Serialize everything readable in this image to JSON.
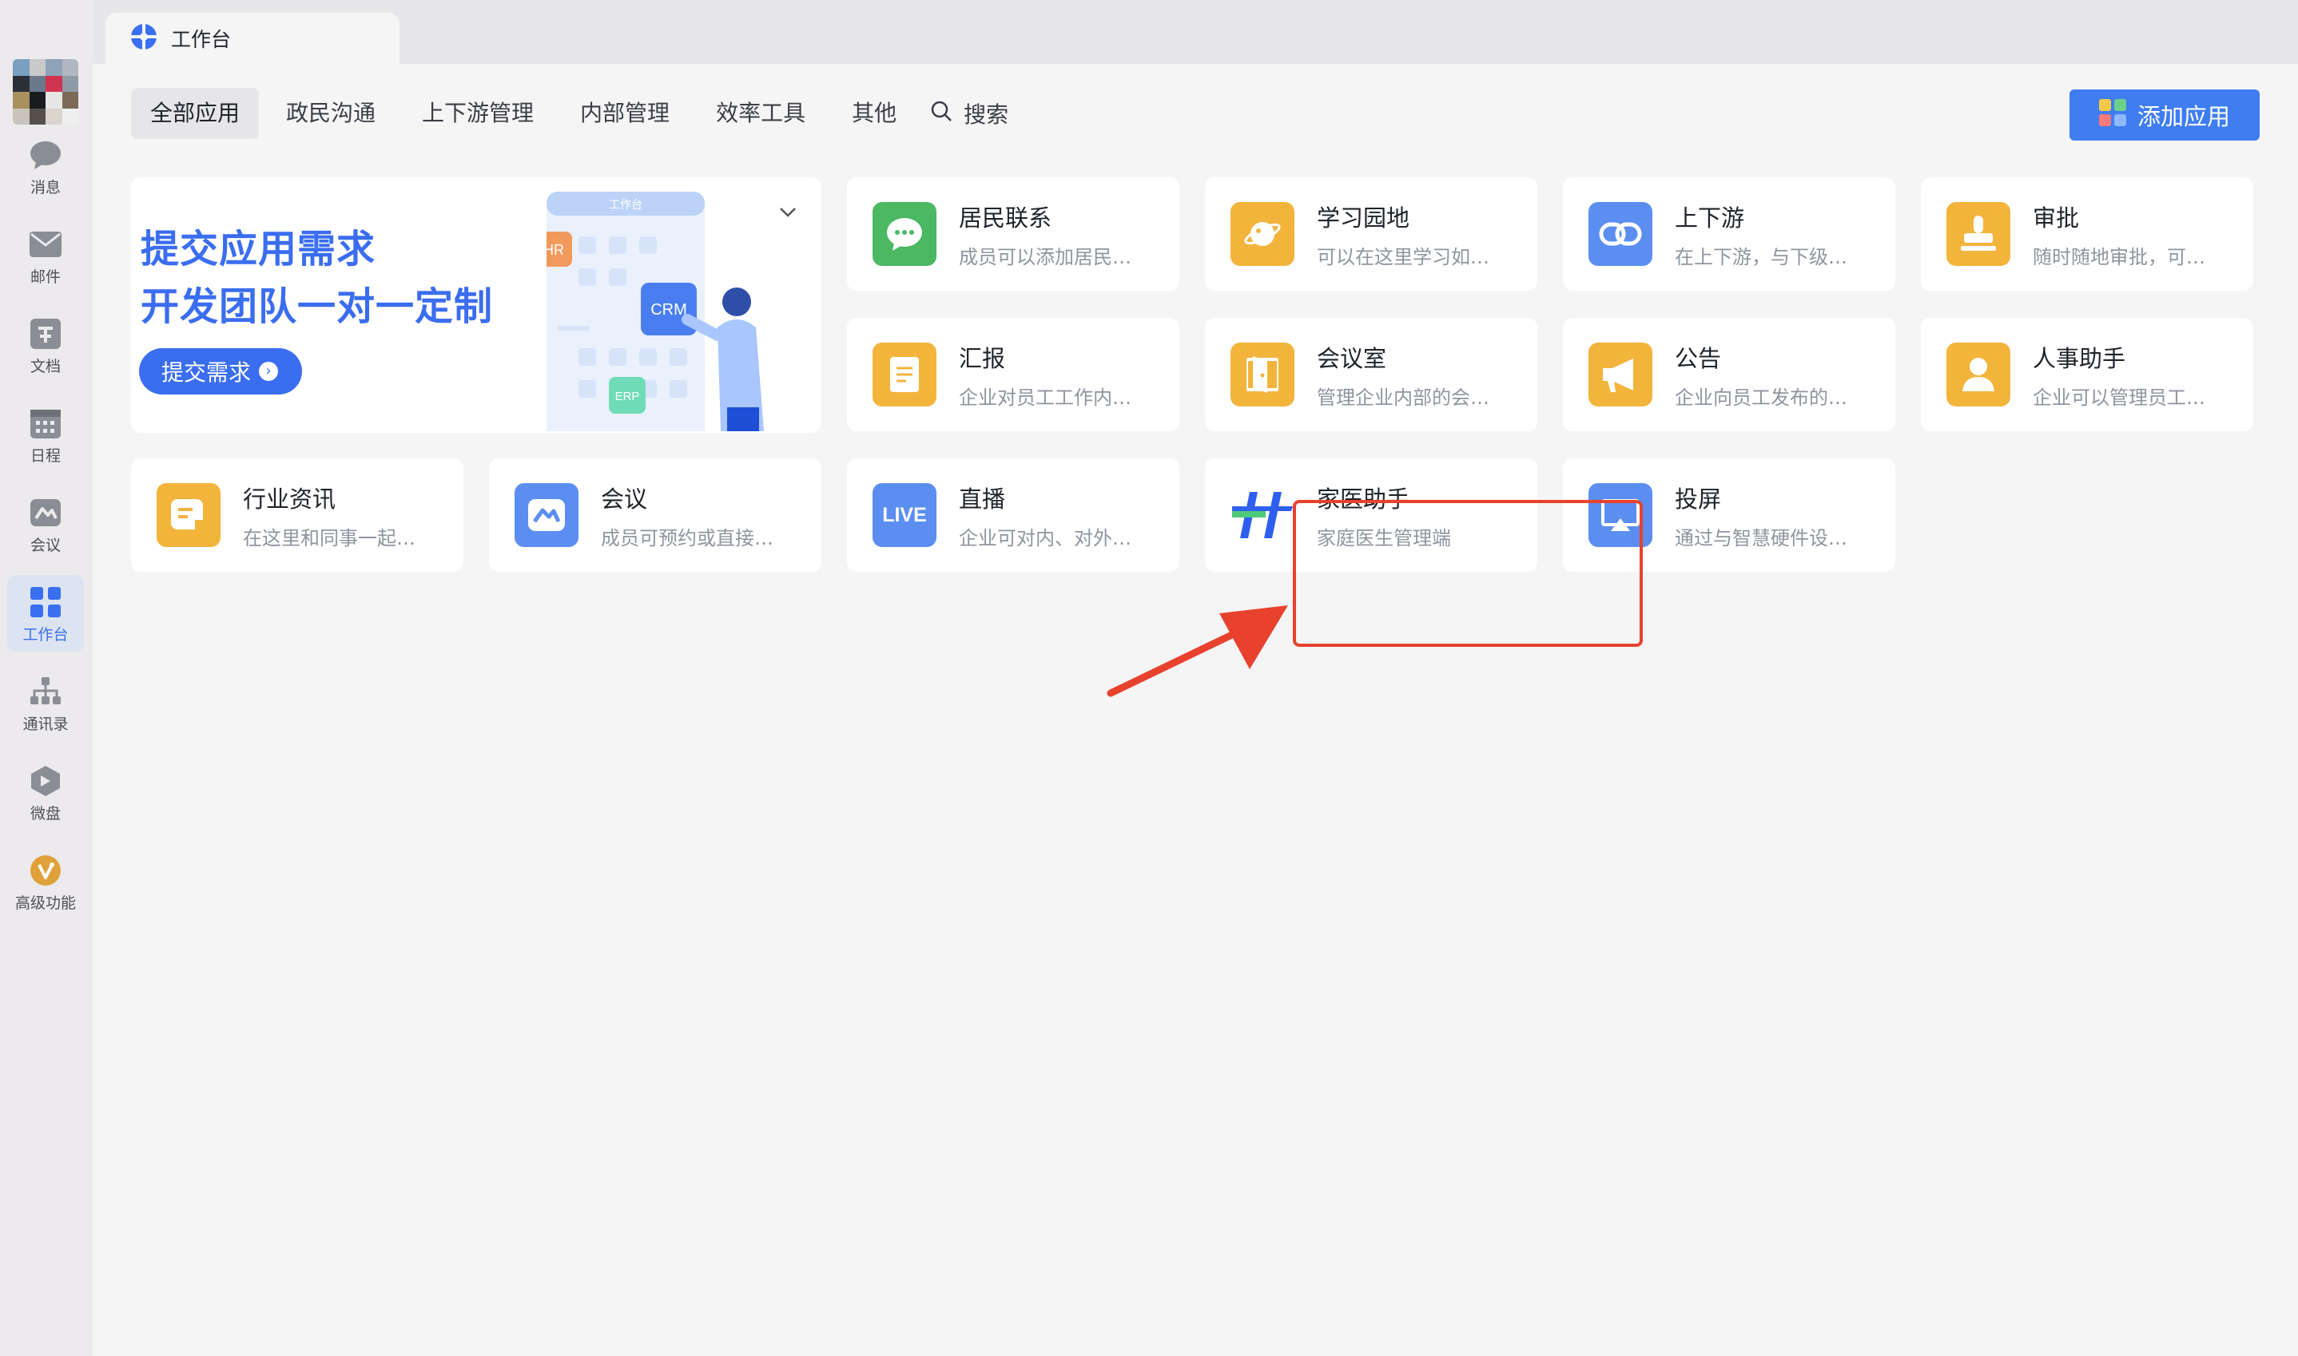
{
  "window_tab": {
    "title": "工作台"
  },
  "sidebar": {
    "items": [
      {
        "label": "消息",
        "icon": "chat-bubble-icon"
      },
      {
        "label": "邮件",
        "icon": "mail-icon"
      },
      {
        "label": "文档",
        "icon": "document-icon"
      },
      {
        "label": "日程",
        "icon": "calendar-icon"
      },
      {
        "label": "会议",
        "icon": "meeting-icon"
      },
      {
        "label": "工作台",
        "icon": "grid-icon",
        "active": true
      },
      {
        "label": "通讯录",
        "icon": "org-chart-icon"
      },
      {
        "label": "微盘",
        "icon": "drive-icon"
      },
      {
        "label": "高级功能",
        "icon": "premium-badge-icon"
      }
    ]
  },
  "categories": [
    "全部应用",
    "政民沟通",
    "上下游管理",
    "内部管理",
    "效率工具",
    "其他"
  ],
  "search": {
    "label": "搜索"
  },
  "add_app_button": "添加应用",
  "banner": {
    "line1": "提交应用需求",
    "line2": "开发团队一对一定制",
    "button": "提交需求",
    "illustration_labels": {
      "screen_title": "工作台",
      "hr": "HR",
      "crm": "CRM",
      "erp": "ERP"
    }
  },
  "apps": [
    {
      "name": "居民联系",
      "desc": "成员可以添加居民…",
      "icon": "chat-icon",
      "color": "#4bb862"
    },
    {
      "name": "学习园地",
      "desc": "可以在这里学习如…",
      "icon": "planet-icon",
      "color": "#f3b43c"
    },
    {
      "name": "上下游",
      "desc": "在上下游，与下级…",
      "icon": "link-icon",
      "color": "#5b8ef0"
    },
    {
      "name": "审批",
      "desc": "随时随地审批，可…",
      "icon": "stamp-icon",
      "color": "#f3b43c"
    },
    {
      "name": "汇报",
      "desc": "企业对员工工作内…",
      "icon": "report-icon",
      "color": "#f3b43c"
    },
    {
      "name": "会议室",
      "desc": "管理企业内部的会…",
      "icon": "door-icon",
      "color": "#f3b43c"
    },
    {
      "name": "公告",
      "desc": "企业向员工发布的…",
      "icon": "megaphone-icon",
      "color": "#f3b43c"
    },
    {
      "name": "人事助手",
      "desc": "企业可以管理员工…",
      "icon": "person-icon",
      "color": "#f3b43c"
    },
    {
      "name": "行业资讯",
      "desc": "在这里和同事一起…",
      "icon": "news-icon",
      "color": "#f3b43c"
    },
    {
      "name": "会议",
      "desc": "成员可预约或直接…",
      "icon": "meeting-icon",
      "color": "#5b8ef0"
    },
    {
      "name": "直播",
      "desc": "企业可对内、对外…",
      "icon": "live-icon",
      "color": "#5b8ef0",
      "icon_text": "LIVE"
    },
    {
      "name": "家医助手",
      "desc": "家庭医生管理端",
      "icon": "family-doctor-logo-icon",
      "color": "#ffffff"
    },
    {
      "name": "投屏",
      "desc": "通过与智慧硬件设…",
      "icon": "screen-cast-icon",
      "color": "#5b8ef0"
    }
  ]
}
